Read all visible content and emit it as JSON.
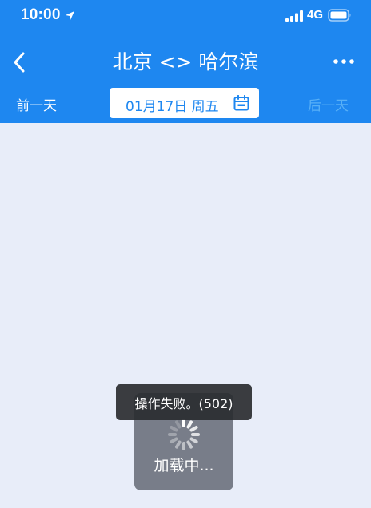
{
  "status_bar": {
    "time": "10:00",
    "location_icon": "location-arrow-icon",
    "signal_icon": "cellular-signal-icon",
    "network": "4G",
    "battery_icon": "battery-icon"
  },
  "nav": {
    "back_icon": "chevron-left-icon",
    "title": "北京 <> 哈尔滨",
    "more_icon": "more-dots-icon"
  },
  "date_bar": {
    "prev_day": "前一天",
    "date": "01月17日 周五",
    "calendar_icon": "calendar-icon",
    "next_day": "后一天"
  },
  "loading": {
    "spinner_icon": "spinner-icon",
    "label": "加载中..."
  },
  "toast": {
    "message": "操作失败。(502)"
  },
  "colors": {
    "primary": "#1e87f0",
    "background": "#e8edf9",
    "next_day_disabled": "#58b0f7",
    "toast_bg": "#2a2c30",
    "loading_bg": "#5f6470"
  }
}
